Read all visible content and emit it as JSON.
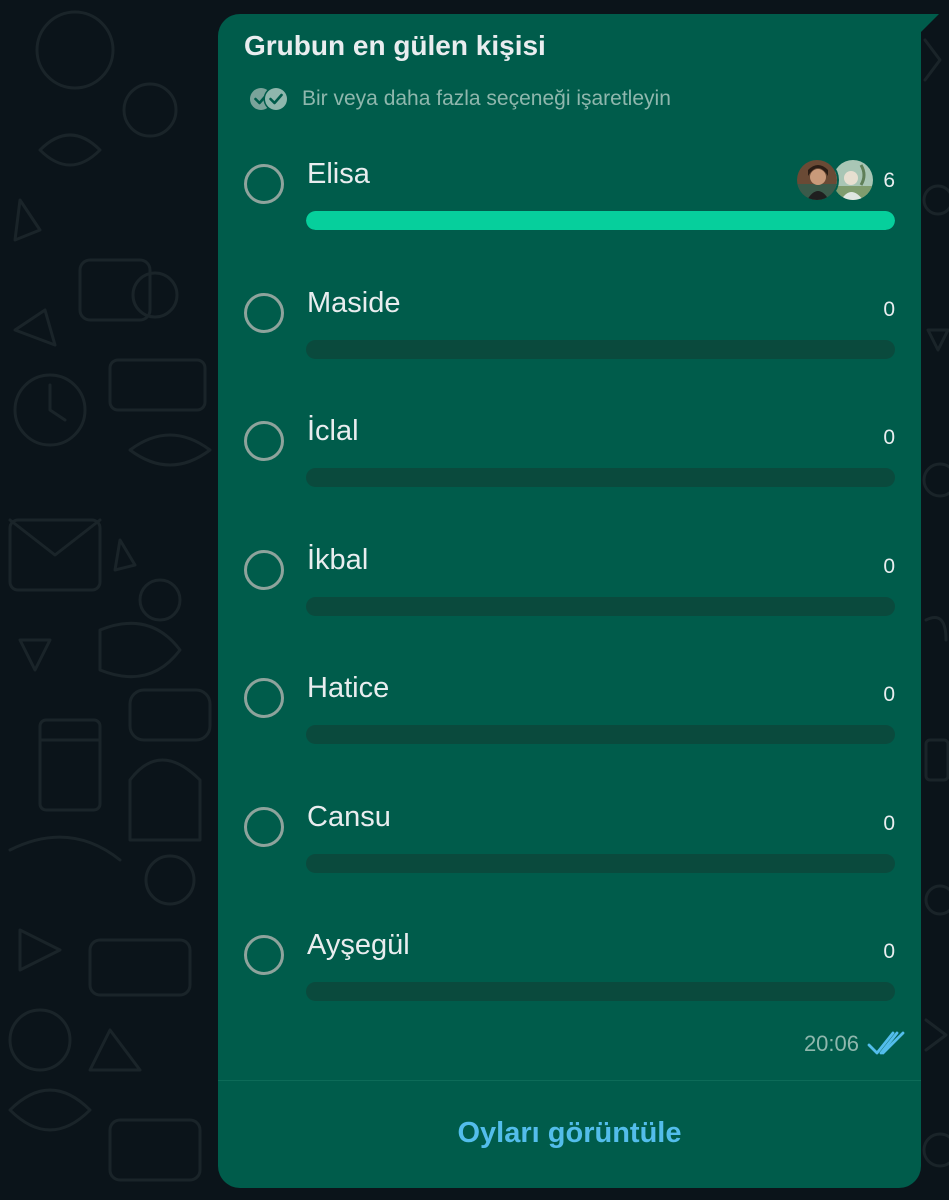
{
  "poll": {
    "title": "Grubun en gülen kişisi",
    "subtitle": "Bir veya daha fazla seçeneği işaretleyin",
    "multi_select_icon": "double-check-circles-icon",
    "options": [
      {
        "label": "Elisa",
        "count": "6",
        "fraction": 1.0,
        "voter_avatars": true
      },
      {
        "label": "Maside",
        "count": "0",
        "fraction": 0
      },
      {
        "label": "İclal",
        "count": "0",
        "fraction": 0
      },
      {
        "label": "İkbal",
        "count": "0",
        "fraction": 0
      },
      {
        "label": "Hatice",
        "count": "0",
        "fraction": 0
      },
      {
        "label": "Cansu",
        "count": "0",
        "fraction": 0
      },
      {
        "label": "Ayşegül",
        "count": "0",
        "fraction": 0
      }
    ],
    "time": "20:06",
    "status_icon": "double-check-read-icon",
    "view_votes_label": "Oyları görüntüle"
  },
  "colors": {
    "chat_background": "#0b141a",
    "bubble": "#005c4b",
    "bar_fill": "#06cf9c",
    "bar_track": "#0a4a3d",
    "link": "#53bdeb",
    "read_ticks": "#53bdeb"
  }
}
